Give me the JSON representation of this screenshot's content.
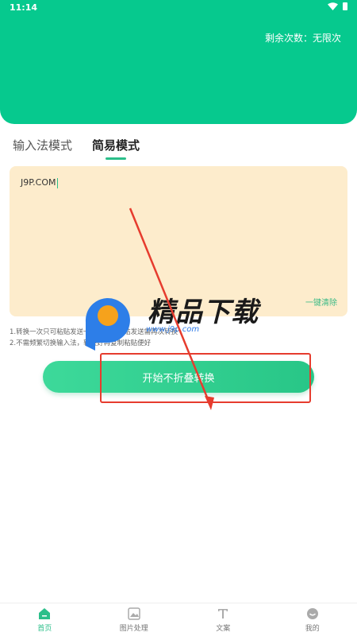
{
  "status_bar": {
    "time": "11:14"
  },
  "header": {
    "remaining_label": "剩余次数：无限次",
    "accent_color": "#06c98e"
  },
  "tabs": [
    {
      "label": "输入法模式",
      "active": false
    },
    {
      "label": "简易模式",
      "active": true
    }
  ],
  "input": {
    "value": "J9P.COM",
    "clear_label": "一键清除"
  },
  "tips": {
    "line1": "1.转换一次只可粘贴发送一次，再次粘贴发送需再次转换",
    "line2": "2.不需频繁切换输入法，转换好再复制粘贴便好"
  },
  "start_button": {
    "label": "开始不折叠转换"
  },
  "watermark": {
    "title": "精品下载",
    "url": "www.j9p.com"
  },
  "bottom_nav": [
    {
      "label": "首页",
      "icon": "home-icon",
      "active": true
    },
    {
      "label": "图片处理",
      "icon": "image-icon",
      "active": false
    },
    {
      "label": "文案",
      "icon": "text-icon",
      "active": false
    },
    {
      "label": "我的",
      "icon": "profile-icon",
      "active": false
    }
  ]
}
